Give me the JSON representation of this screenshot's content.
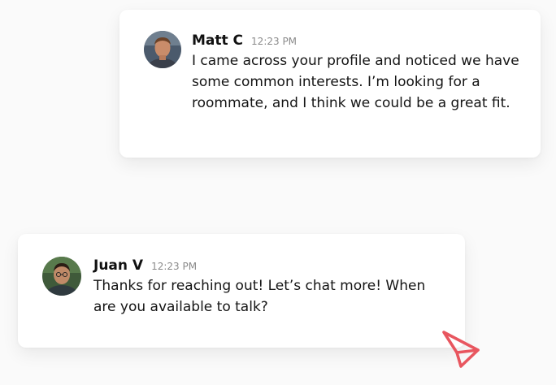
{
  "messages": [
    {
      "sender": "Matt C",
      "time": "12:23 PM",
      "text": "I came across your profile and noticed we have some common interests. I’m looking for a roommate, and I think we could be a great fit."
    },
    {
      "sender": "Juan V",
      "time": "12:23 PM",
      "text": "Thanks for reaching out! Let’s chat more! When are you available to talk?"
    }
  ],
  "icons": {
    "send": "send-icon",
    "avatar_matt": "user-avatar-icon",
    "avatar_juan": "user-avatar-icon"
  },
  "colors": {
    "send_accent": "#e8565f",
    "background": "#fafafa",
    "card": "#ffffff",
    "timestamp": "#8a8a8a"
  }
}
